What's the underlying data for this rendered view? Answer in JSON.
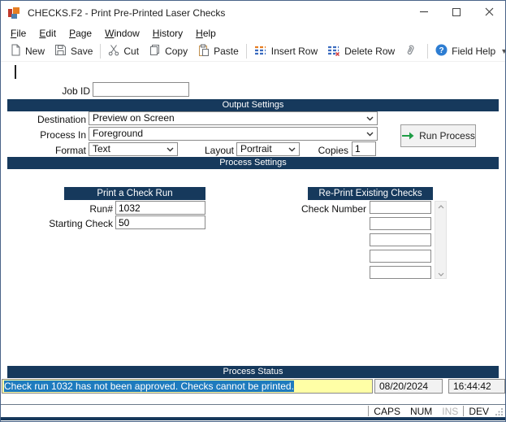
{
  "window": {
    "title": "CHECKS.F2 - Print Pre-Printed Laser Checks"
  },
  "menu": {
    "items": [
      {
        "label": "File"
      },
      {
        "label": "Edit"
      },
      {
        "label": "Page"
      },
      {
        "label": "Window"
      },
      {
        "label": "History"
      },
      {
        "label": "Help"
      }
    ]
  },
  "toolbar": {
    "items": [
      {
        "icon": "new-document-icon",
        "label": "New"
      },
      {
        "icon": "save-icon",
        "label": "Save"
      },
      {
        "icon": "cut-icon",
        "label": "Cut"
      },
      {
        "icon": "copy-icon",
        "label": "Copy"
      },
      {
        "icon": "paste-icon",
        "label": "Paste"
      },
      {
        "icon": "insert-row-icon",
        "label": "Insert Row"
      },
      {
        "icon": "delete-row-icon",
        "label": "Delete Row"
      },
      {
        "icon": "paperclip-icon",
        "label": ""
      },
      {
        "icon": "field-help-icon",
        "label": "Field Help"
      }
    ],
    "overflow_icon": "▼"
  },
  "job": {
    "label": "Job ID",
    "value": ""
  },
  "sections": {
    "output": "Output Settings",
    "process": "Process Settings",
    "status": "Process Status"
  },
  "output": {
    "destination_label": "Destination",
    "destination_value": "Preview on Screen",
    "process_in_label": "Process In",
    "process_in_value": "Foreground",
    "format_label": "Format",
    "format_value": "Text",
    "layout_label": "Layout",
    "layout_value": "Portrait",
    "copies_label": "Copies",
    "copies_value": "1",
    "run_button_label": "Run Process"
  },
  "print_run": {
    "title": "Print a Check Run",
    "run_label": "Run#",
    "run_value": "1032",
    "starting_label": "Starting Check",
    "starting_value": "50"
  },
  "reprint": {
    "title": "Re-Print Existing Checks",
    "check_label": "Check Number",
    "check_numbers": [
      "",
      "",
      "",
      "",
      ""
    ]
  },
  "status": {
    "message": "Check run 1032 has not been approved. Checks cannot be printed.",
    "date": "08/20/2024",
    "time": "16:44:42"
  },
  "statusbar": {
    "caps": "CAPS",
    "num": "NUM",
    "ins": "INS",
    "dev": "DEV"
  },
  "colors": {
    "header_bar": "#16395C",
    "selection_blue": "#1E7BBE",
    "status_highlight_yellow": "#FFFFA6",
    "run_arrow_green": "#1F9D46",
    "field_help_blue": "#2D7DD2",
    "app_icon_red": "#C0392B",
    "app_icon_orange": "#E67E22",
    "app_icon_blue": "#4D7FAE"
  }
}
